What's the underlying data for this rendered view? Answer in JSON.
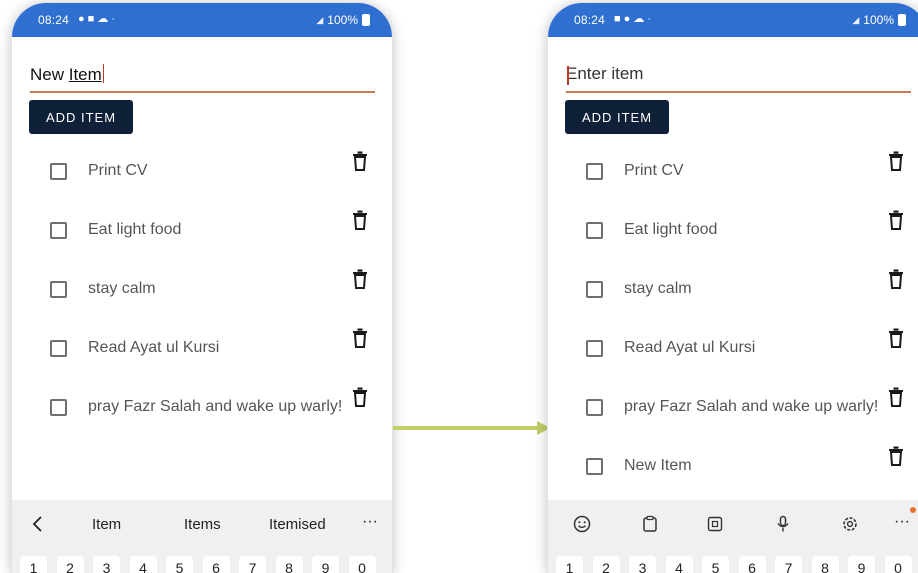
{
  "before": {
    "status": {
      "time": "08:24",
      "battery": "100%"
    },
    "input_value_prefix": "New ",
    "input_value_underlined": "Item",
    "add_button": "ADD ITEM",
    "items": [
      "Print CV",
      "Eat light food",
      "stay calm",
      "Read Ayat ul Kursi",
      "pray Fazr Salah and wake up warly!"
    ],
    "keyboard_suggestions": [
      "Item",
      "Items",
      "Itemised"
    ],
    "more": "···",
    "keys": [
      "1",
      "2",
      "3",
      "4",
      "5",
      "6",
      "7",
      "8",
      "9",
      "0"
    ]
  },
  "after": {
    "status": {
      "time": "08:24",
      "battery": "100%"
    },
    "input_placeholder": "Enter item",
    "add_button": "ADD ITEM",
    "items": [
      "Print CV",
      "Eat light food",
      "stay calm",
      "Read Ayat ul Kursi",
      "pray Fazr Salah and wake up warly!",
      "New Item"
    ],
    "toolbar_icons": [
      "emoji-icon",
      "clipboard-icon",
      "keyboard-mode-icon",
      "microphone-icon",
      "settings-icon"
    ],
    "more": "···",
    "keys": [
      "1",
      "2",
      "3",
      "4",
      "5",
      "6",
      "7",
      "8",
      "9",
      "0"
    ]
  },
  "colors": {
    "statusbar": "#2f6fd0",
    "button": "#0f2138",
    "input_underline": "#c77a57",
    "arrow": "#c3cd6a"
  }
}
